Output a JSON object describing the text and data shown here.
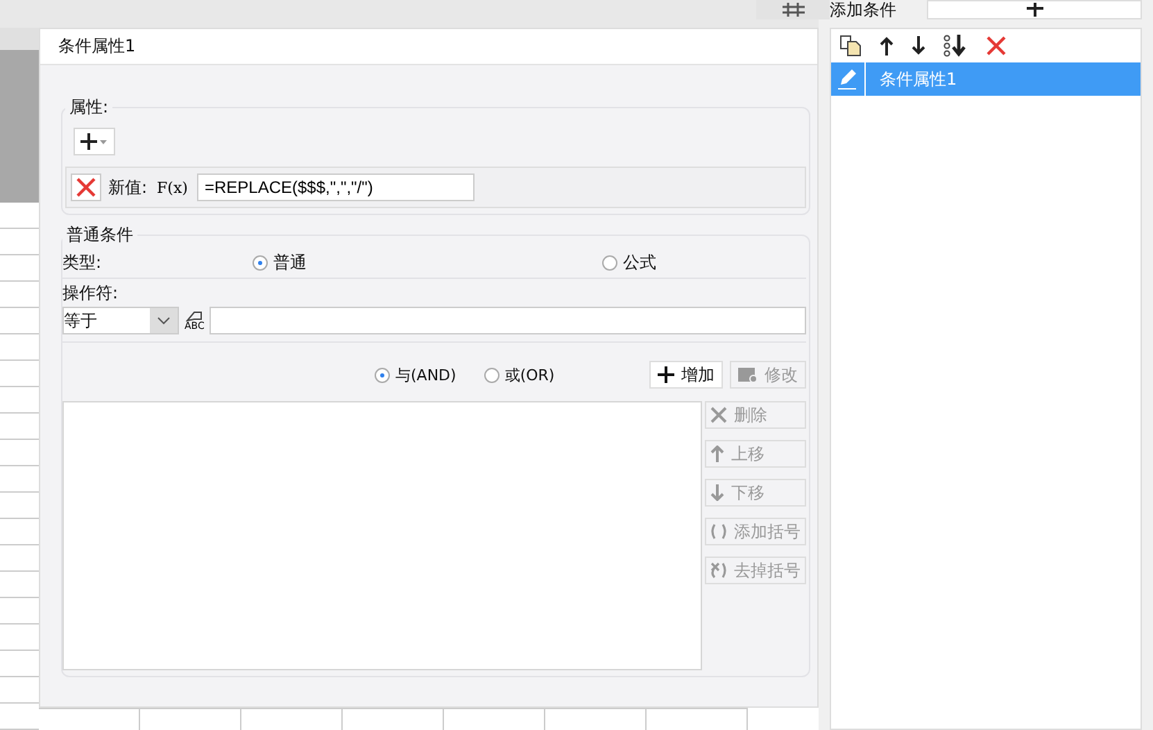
{
  "dialog": {
    "title": "条件属性1"
  },
  "properties": {
    "legend": "属性:",
    "rows": [
      {
        "label": "新值:",
        "formula_button": "F(x)",
        "value": "=REPLACE($$$,\",\",\"/\")"
      }
    ]
  },
  "condition": {
    "legend": "普通条件",
    "type_label": "类型:",
    "types": [
      {
        "label": "普通",
        "selected": true
      },
      {
        "label": "公式",
        "selected": false
      }
    ],
    "operator_label": "操作符:",
    "operator": "等于",
    "value_type_button": "ABC",
    "logic": [
      {
        "label": "与(AND)",
        "selected": true
      },
      {
        "label": "或(OR)",
        "selected": false
      }
    ],
    "buttons": [
      {
        "kind": "add",
        "label": "增加",
        "disabled": false
      },
      {
        "kind": "edit",
        "label": "修改",
        "disabled": true
      },
      {
        "kind": "delete",
        "label": "删除",
        "disabled": true
      },
      {
        "kind": "up",
        "label": "上移",
        "disabled": true
      },
      {
        "kind": "down",
        "label": "下移",
        "disabled": true
      },
      {
        "kind": "bracket",
        "label": "添加括号",
        "disabled": true
      },
      {
        "kind": "unbracket",
        "label": "去掉括号",
        "disabled": true
      }
    ]
  },
  "conditions_panel": {
    "title": "添加条件",
    "items": [
      {
        "label": "条件属性1",
        "selected": true
      }
    ]
  }
}
